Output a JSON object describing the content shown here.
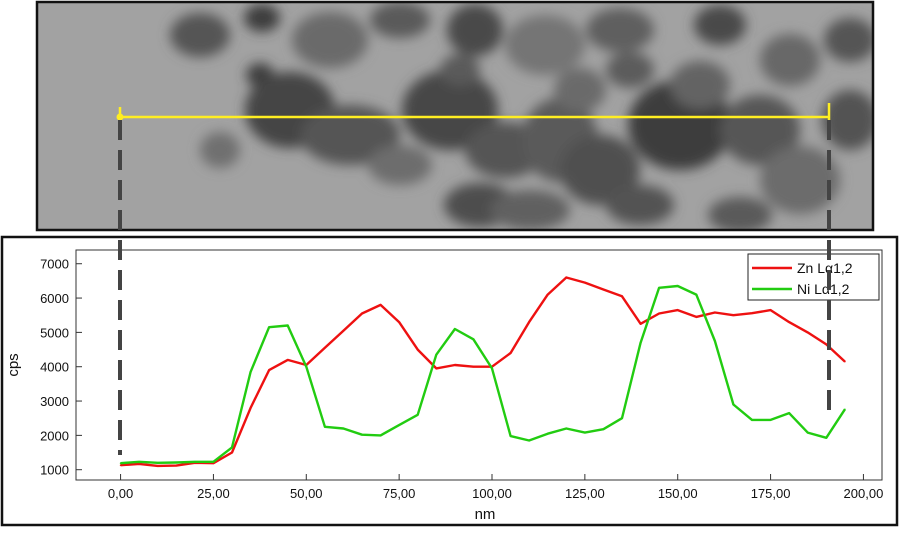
{
  "colors": {
    "zn": "#ee1111",
    "ni": "#22cc11",
    "line_scan": "#ffee22",
    "guide": "#444444",
    "frame": "#111111",
    "micrograph_bg": "#a2a2a2"
  },
  "chart_data": {
    "type": "line",
    "xlabel": "nm",
    "ylabel": "cps",
    "xlim": [
      -12,
      205
    ],
    "ylim": [
      700,
      7400
    ],
    "x_ticks": [
      0,
      25,
      50,
      75,
      100,
      125,
      150,
      175,
      200
    ],
    "x_tick_labels": [
      "0,00",
      "25,00",
      "50,00",
      "75,00",
      "100,00",
      "125,00",
      "150,00",
      "175,00",
      "200,00"
    ],
    "y_ticks": [
      1000,
      2000,
      3000,
      4000,
      5000,
      6000,
      7000
    ],
    "y_tick_labels": [
      "1000",
      "2000",
      "3000",
      "4000",
      "5000",
      "6000",
      "7000"
    ],
    "legend_position": "top-right",
    "grid": false,
    "series": [
      {
        "name": "Zn Lα1,2",
        "color": "#ee1111",
        "x": [
          0,
          5,
          10,
          15,
          20,
          25,
          30,
          35,
          40,
          45,
          50,
          55,
          60,
          65,
          70,
          75,
          80,
          85,
          90,
          95,
          100,
          105,
          110,
          115,
          120,
          125,
          130,
          135,
          140,
          145,
          150,
          155,
          160,
          165,
          170,
          175,
          180,
          185,
          190,
          195
        ],
        "values": [
          1130,
          1170,
          1110,
          1120,
          1200,
          1190,
          1500,
          2800,
          3900,
          4200,
          4050,
          4550,
          5050,
          5550,
          5800,
          5300,
          4500,
          3950,
          4050,
          4000,
          4000,
          4400,
          5300,
          6100,
          6600,
          6450,
          6250,
          6050,
          5250,
          5550,
          5650,
          5450,
          5580,
          5500,
          5560,
          5650,
          5300,
          5000,
          4650,
          4150
        ]
      },
      {
        "name": "Ni Lα1,2",
        "color": "#22cc11",
        "x": [
          0,
          5,
          10,
          15,
          20,
          25,
          30,
          35,
          40,
          45,
          50,
          55,
          60,
          65,
          70,
          75,
          80,
          85,
          90,
          95,
          100,
          105,
          110,
          115,
          120,
          125,
          130,
          135,
          140,
          145,
          150,
          155,
          160,
          165,
          170,
          175,
          180,
          185,
          190,
          195
        ],
        "values": [
          1190,
          1230,
          1200,
          1210,
          1230,
          1230,
          1650,
          3850,
          5150,
          5200,
          4000,
          2250,
          2200,
          2020,
          2000,
          2300,
          2600,
          4350,
          5100,
          4800,
          3950,
          1980,
          1850,
          2050,
          2200,
          2080,
          2180,
          2500,
          4700,
          6300,
          6350,
          6100,
          4750,
          2900,
          2450,
          2450,
          2650,
          2080,
          1930,
          2760
        ]
      }
    ]
  }
}
